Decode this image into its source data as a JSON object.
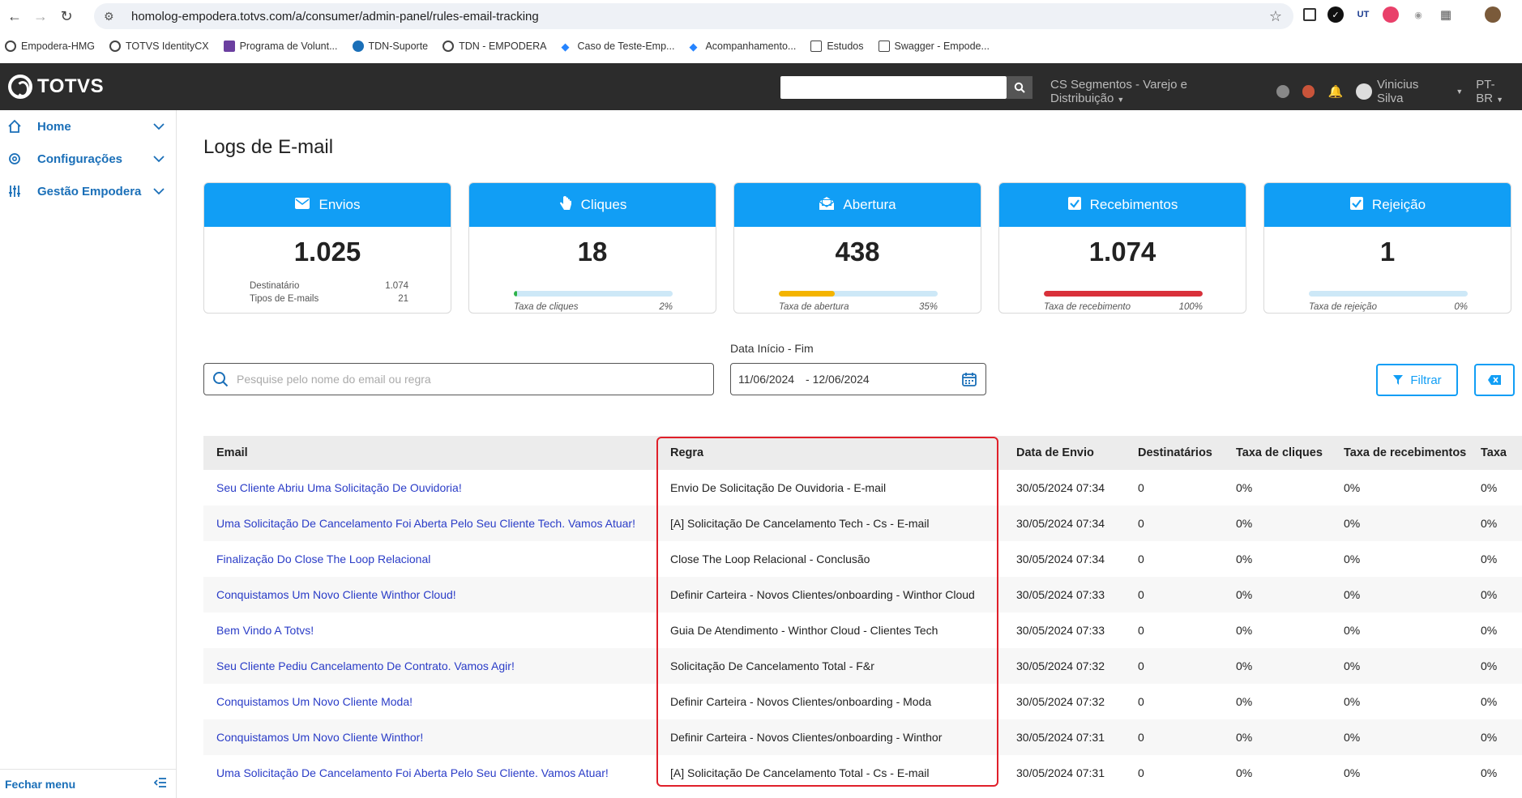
{
  "browser": {
    "url": "homolog-empodera.totvs.com/a/consumer/admin-panel/rules-email-tracking",
    "bookmarks": [
      "Empodera-HMG",
      "TOTVS IdentityCX",
      "Programa de Volunt...",
      "TDN-Suporte",
      "TDN - EMPODERA",
      "Caso de Teste-Emp...",
      "Acompanhamento...",
      "Estudos",
      "Swagger - Empode..."
    ]
  },
  "header": {
    "logo": "TOTVS",
    "segment": "CS Segmentos - Varejo e Distribuição",
    "user": "Vinicius Silva",
    "language": "PT-BR"
  },
  "sidebar": {
    "items": [
      {
        "label": "Home",
        "icon": "home-icon"
      },
      {
        "label": "Configurações",
        "icon": "gear-icon"
      },
      {
        "label": "Gestão Empodera",
        "icon": "sliders-icon"
      }
    ],
    "footer": "Fechar menu"
  },
  "page": {
    "title": "Logs de E-mail"
  },
  "cards": {
    "envios": {
      "title": "Envios",
      "value": "1.025",
      "meta": [
        {
          "label": "Destinatário",
          "value": "1.074"
        },
        {
          "label": "Tipos de E-mails",
          "value": "21"
        }
      ]
    },
    "cliques": {
      "title": "Cliques",
      "value": "18",
      "rate_label": "Taxa de cliques",
      "rate": "2%",
      "fill": 0.02,
      "color": "#2fb34a"
    },
    "abertura": {
      "title": "Abertura",
      "value": "438",
      "rate_label": "Taxa de abertura",
      "rate": "35%",
      "fill": 0.35,
      "color": "#f4b400"
    },
    "recebimentos": {
      "title": "Recebimentos",
      "value": "1.074",
      "rate_label": "Taxa de recebimento",
      "rate": "100%",
      "fill": 1.0,
      "color": "#d9313a"
    },
    "rejeicao": {
      "title": "Rejeição",
      "value": "1",
      "rate_label": "Taxa de rejeição",
      "rate": "0%",
      "fill": 0.0,
      "color": "#119ef5"
    }
  },
  "filters": {
    "search_placeholder": "Pesquise pelo nome do email ou regra",
    "date_label": "Data Início - Fim",
    "date_start": "11/06/2024",
    "date_end": "- 12/06/2024",
    "filter_button": "Filtrar"
  },
  "table": {
    "headers": [
      "Email",
      "Regra",
      "Data de Envio",
      "Destinatários",
      "Taxa de cliques",
      "Taxa de recebimentos",
      "Taxa"
    ],
    "rows": [
      [
        "Seu Cliente Abriu Uma Solicitação De Ouvidoria!",
        "Envio De Solicitação De Ouvidoria - E-mail",
        "30/05/2024 07:34",
        "0",
        "0%",
        "0%",
        "0%"
      ],
      [
        "Uma Solicitação De Cancelamento Foi Aberta Pelo Seu Cliente Tech. Vamos Atuar!",
        "[A] Solicitação De Cancelamento Tech - Cs - E-mail",
        "30/05/2024 07:34",
        "0",
        "0%",
        "0%",
        "0%"
      ],
      [
        "Finalização Do Close The Loop Relacional",
        "Close The Loop Relacional - Conclusão",
        "30/05/2024 07:34",
        "0",
        "0%",
        "0%",
        "0%"
      ],
      [
        "Conquistamos Um Novo Cliente Winthor Cloud!",
        "Definir Carteira - Novos Clientes/onboarding - Winthor Cloud",
        "30/05/2024 07:33",
        "0",
        "0%",
        "0%",
        "0%"
      ],
      [
        "Bem Vindo A Totvs!",
        "Guia De Atendimento - Winthor Cloud - Clientes Tech",
        "30/05/2024 07:33",
        "0",
        "0%",
        "0%",
        "0%"
      ],
      [
        "Seu Cliente Pediu Cancelamento De Contrato. Vamos Agir!",
        "Solicitação De Cancelamento Total - F&r",
        "30/05/2024 07:32",
        "0",
        "0%",
        "0%",
        "0%"
      ],
      [
        "Conquistamos Um Novo Cliente Moda!",
        "Definir Carteira - Novos Clientes/onboarding - Moda",
        "30/05/2024 07:32",
        "0",
        "0%",
        "0%",
        "0%"
      ],
      [
        "Conquistamos Um Novo Cliente Winthor!",
        "Definir Carteira - Novos Clientes/onboarding - Winthor",
        "30/05/2024 07:31",
        "0",
        "0%",
        "0%",
        "0%"
      ],
      [
        "Uma Solicitação De Cancelamento Foi Aberta Pelo Seu Cliente. Vamos Atuar!",
        "[A] Solicitação De Cancelamento Total - Cs - E-mail",
        "30/05/2024 07:31",
        "0",
        "0%",
        "0%",
        "0%"
      ]
    ]
  },
  "colors": {
    "accent": "#119ef5",
    "link": "#2a3cc7",
    "highlight": "#e0202a"
  }
}
